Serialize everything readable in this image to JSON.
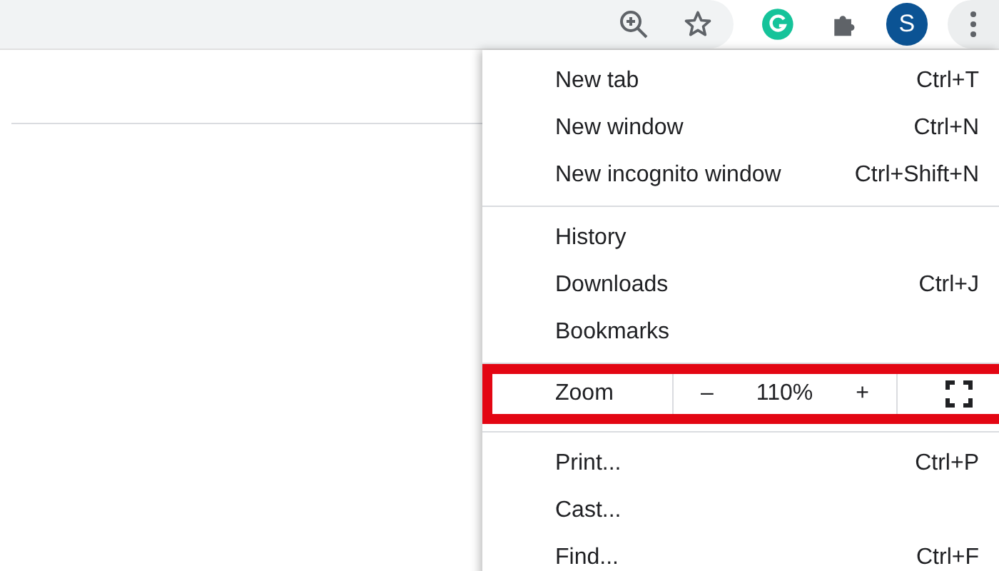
{
  "toolbar": {
    "avatar_letter": "S"
  },
  "menu": {
    "sections": [
      {
        "items": [
          {
            "kind": "item",
            "label": "New tab",
            "shortcut": "Ctrl+T"
          },
          {
            "kind": "item",
            "label": "New window",
            "shortcut": "Ctrl+N"
          },
          {
            "kind": "item",
            "label": "New incognito window",
            "shortcut": "Ctrl+Shift+N"
          }
        ]
      },
      {
        "items": [
          {
            "kind": "item",
            "label": "History"
          },
          {
            "kind": "item",
            "label": "Downloads",
            "shortcut": "Ctrl+J"
          },
          {
            "kind": "item",
            "label": "Bookmarks"
          }
        ]
      },
      {
        "items": [
          {
            "kind": "zoom",
            "label": "Zoom",
            "minus": "–",
            "value": "110%",
            "plus": "+",
            "highlighted": true
          }
        ]
      },
      {
        "items": [
          {
            "kind": "item",
            "label": "Print...",
            "shortcut": "Ctrl+P"
          },
          {
            "kind": "item",
            "label": "Cast..."
          },
          {
            "kind": "item",
            "label": "Find...",
            "shortcut": "Ctrl+F"
          }
        ]
      }
    ]
  }
}
